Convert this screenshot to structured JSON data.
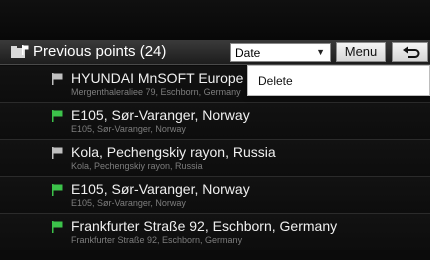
{
  "header": {
    "title": "Previous points (24)",
    "sort_value": "Date",
    "menu_label": "Menu"
  },
  "context_menu": {
    "items": [
      "Delete"
    ]
  },
  "list": {
    "items": [
      {
        "name": "HYUNDAI MnSOFT Europe",
        "address": "Mergenthaleraliee 79, Eschborn, Germany",
        "flag_color": "#bfbfbf"
      },
      {
        "name": "E105, Sør-Varanger, Norway",
        "address": "E105, Sør-Varanger, Norway",
        "flag_color": "#3cc24a"
      },
      {
        "name": "Kola, Pechengskiy rayon, Russia",
        "address": "Kola, Pechengskiy rayon, Russia",
        "flag_color": "#bfbfbf"
      },
      {
        "name": "E105, Sør-Varanger, Norway",
        "address": "E105, Sør-Varanger, Norway",
        "flag_color": "#3cc24a"
      },
      {
        "name": "Frankfurter Straße 92, Eschborn, Germany",
        "address": "Frankfurter Straße 92, Eschborn, Germany",
        "flag_color": "#3cc24a"
      }
    ]
  },
  "icons": {
    "header": "folder-flag-icon",
    "back": "back-arrow-icon",
    "sort": "chevron-down-icon",
    "row": "flag-icon"
  }
}
